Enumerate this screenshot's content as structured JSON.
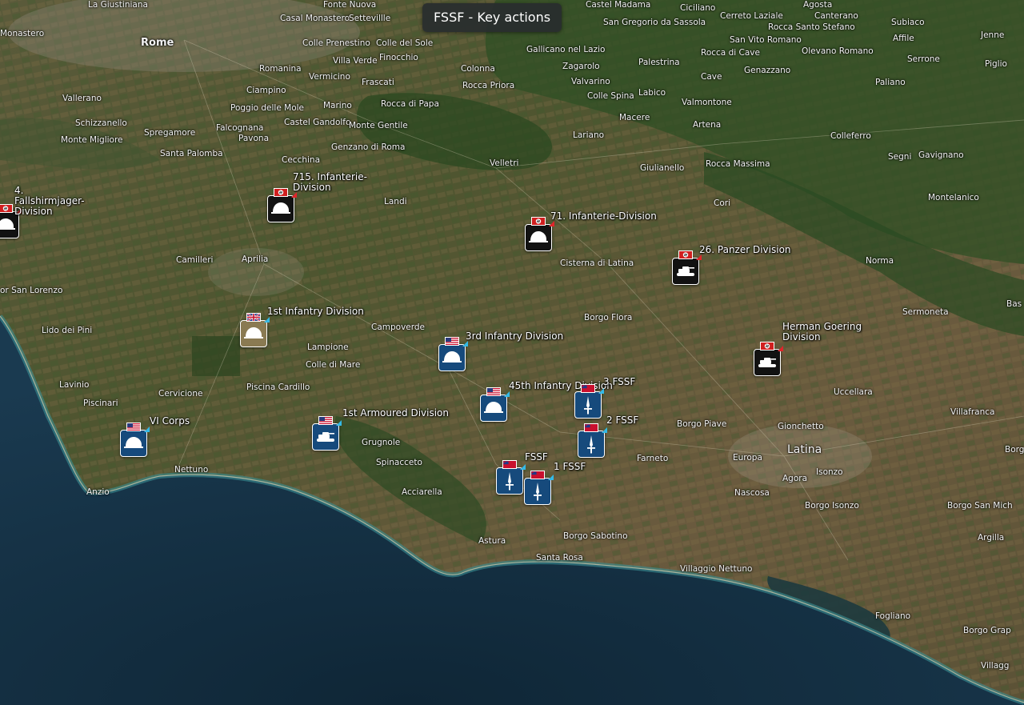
{
  "title_pill": "FSSF - Key actions",
  "places": [
    {
      "name": "La Giustiniana",
      "cls": ""
    },
    {
      "name": "Casal Monastero",
      "cls": ""
    },
    {
      "name": "Settevillle",
      "cls": ""
    },
    {
      "name": "Fonte Nuova",
      "cls": ""
    },
    {
      "name": "Castel Madama",
      "cls": ""
    },
    {
      "name": "Ciciliano",
      "cls": ""
    },
    {
      "name": "Agosta",
      "cls": ""
    },
    {
      "name": "Cerreto Laziale",
      "cls": ""
    },
    {
      "name": "Canterano",
      "cls": ""
    },
    {
      "name": "San Gregorio da Sassola",
      "cls": ""
    },
    {
      "name": "Subiaco",
      "cls": ""
    },
    {
      "name": "Rocca Santo Stefano",
      "cls": ""
    },
    {
      "name": "Jenne",
      "cls": ""
    },
    {
      "name": "Affile",
      "cls": ""
    },
    {
      "name": "Monastero",
      "cls": ""
    },
    {
      "name": "Rome",
      "cls": "city"
    },
    {
      "name": "Colle Prenestino",
      "cls": ""
    },
    {
      "name": "Colle del Sole",
      "cls": ""
    },
    {
      "name": "Gallicano nel Lazio",
      "cls": ""
    },
    {
      "name": "San Vito Romano",
      "cls": ""
    },
    {
      "name": "Rocca di Cave",
      "cls": ""
    },
    {
      "name": "Olevano Romano",
      "cls": ""
    },
    {
      "name": "Serrone",
      "cls": ""
    },
    {
      "name": "Piglio",
      "cls": ""
    },
    {
      "name": "Finocchio",
      "cls": ""
    },
    {
      "name": "Villa Verde",
      "cls": ""
    },
    {
      "name": "Palestrina",
      "cls": ""
    },
    {
      "name": "Zagarolo",
      "cls": ""
    },
    {
      "name": "Colonna",
      "cls": ""
    },
    {
      "name": "Romanina",
      "cls": ""
    },
    {
      "name": "Vermicino",
      "cls": ""
    },
    {
      "name": "Cave",
      "cls": ""
    },
    {
      "name": "Genazzano",
      "cls": ""
    },
    {
      "name": "Frascati",
      "cls": ""
    },
    {
      "name": "Rocca Priora",
      "cls": ""
    },
    {
      "name": "Valvarino",
      "cls": ""
    },
    {
      "name": "Paliano",
      "cls": ""
    },
    {
      "name": "Ciampino",
      "cls": ""
    },
    {
      "name": "Colle Spina",
      "cls": ""
    },
    {
      "name": "Labico",
      "cls": ""
    },
    {
      "name": "Vallerano",
      "cls": ""
    },
    {
      "name": "Marino",
      "cls": ""
    },
    {
      "name": "Rocca di Papa",
      "cls": ""
    },
    {
      "name": "Valmontone",
      "cls": ""
    },
    {
      "name": "Poggio delle Mole",
      "cls": ""
    },
    {
      "name": "Macere",
      "cls": ""
    },
    {
      "name": "Schizzanello",
      "cls": ""
    },
    {
      "name": "Castel Gandolfo",
      "cls": ""
    },
    {
      "name": "Monte Gentile",
      "cls": ""
    },
    {
      "name": "Artena",
      "cls": ""
    },
    {
      "name": "Spregamore",
      "cls": ""
    },
    {
      "name": "Falcognana",
      "cls": ""
    },
    {
      "name": "Lariano",
      "cls": ""
    },
    {
      "name": "Colleferro",
      "cls": ""
    },
    {
      "name": "Monte Migliore",
      "cls": ""
    },
    {
      "name": "Pavona",
      "cls": ""
    },
    {
      "name": "Genzano di Roma",
      "cls": ""
    },
    {
      "name": "Santa Palomba",
      "cls": ""
    },
    {
      "name": "Segni",
      "cls": ""
    },
    {
      "name": "Gavignano",
      "cls": ""
    },
    {
      "name": "Cecchina",
      "cls": ""
    },
    {
      "name": "Velletri",
      "cls": ""
    },
    {
      "name": "Giulianello",
      "cls": ""
    },
    {
      "name": "Rocca Massima",
      "cls": ""
    },
    {
      "name": "Montelanico",
      "cls": ""
    },
    {
      "name": "Landi",
      "cls": ""
    },
    {
      "name": "Cori",
      "cls": ""
    },
    {
      "name": "Camilleri",
      "cls": ""
    },
    {
      "name": "Aprilia",
      "cls": ""
    },
    {
      "name": "Cisterna di Latina",
      "cls": ""
    },
    {
      "name": "Norma",
      "cls": ""
    },
    {
      "name": "or San Lorenzo",
      "cls": ""
    },
    {
      "name": "Sermoneta",
      "cls": ""
    },
    {
      "name": "Bas",
      "cls": ""
    },
    {
      "name": "Borgo Flora",
      "cls": ""
    },
    {
      "name": "Lido dei Pini",
      "cls": ""
    },
    {
      "name": "Campoverde",
      "cls": ""
    },
    {
      "name": "Lampione",
      "cls": ""
    },
    {
      "name": "Colle di Mare",
      "cls": ""
    },
    {
      "name": "Lavinio",
      "cls": ""
    },
    {
      "name": "Piscina Cardillo",
      "cls": ""
    },
    {
      "name": "Uccellara",
      "cls": ""
    },
    {
      "name": "Cervicione",
      "cls": ""
    },
    {
      "name": "Piscinari",
      "cls": ""
    },
    {
      "name": "Villafranca",
      "cls": ""
    },
    {
      "name": "Borgo Piave",
      "cls": ""
    },
    {
      "name": "Gionchetto",
      "cls": ""
    },
    {
      "name": "Grugnole",
      "cls": ""
    },
    {
      "name": "Latina",
      "cls": "big"
    },
    {
      "name": "Borg",
      "cls": ""
    },
    {
      "name": "Europa",
      "cls": ""
    },
    {
      "name": "Farneto",
      "cls": ""
    },
    {
      "name": "Spinacceto",
      "cls": ""
    },
    {
      "name": "Isonzo",
      "cls": ""
    },
    {
      "name": "Agora",
      "cls": ""
    },
    {
      "name": "Nettuno",
      "cls": ""
    },
    {
      "name": "Acciarella",
      "cls": ""
    },
    {
      "name": "Anzio",
      "cls": ""
    },
    {
      "name": "Nascosa",
      "cls": ""
    },
    {
      "name": "Borgo Isonzo",
      "cls": ""
    },
    {
      "name": "Borgo San Mich",
      "cls": ""
    },
    {
      "name": "Argilla",
      "cls": ""
    },
    {
      "name": "Borgo Sabotino",
      "cls": ""
    },
    {
      "name": "Astura",
      "cls": ""
    },
    {
      "name": "Santa Rosa",
      "cls": ""
    },
    {
      "name": "Villaggio Nettuno",
      "cls": ""
    },
    {
      "name": "Fogliano",
      "cls": ""
    },
    {
      "name": "Borgo Grap",
      "cls": ""
    },
    {
      "name": "Villagg",
      "cls": ""
    }
  ],
  "units": [
    {
      "id": "4-fallshirmjager",
      "label": "4. Fallshirmjager-Division",
      "nation": "germany",
      "type": "infantry"
    },
    {
      "id": "715-infanterie",
      "label": "715. Infanterie-Division",
      "nation": "germany",
      "type": "infantry"
    },
    {
      "id": "71-infanterie",
      "label": "71. Infanterie-Division",
      "nation": "germany",
      "type": "infantry"
    },
    {
      "id": "26-panzer",
      "label": "26. Panzer Division",
      "nation": "germany",
      "type": "armour"
    },
    {
      "id": "herman-goering",
      "label": "Herman Goering Division",
      "nation": "germany",
      "type": "armour"
    },
    {
      "id": "1st-infantry",
      "label": "1st Infantry Division",
      "nation": "uk",
      "type": "infantry"
    },
    {
      "id": "3rd-infantry",
      "label": "3rd Infantry Division",
      "nation": "us",
      "type": "infantry"
    },
    {
      "id": "45th-infantry",
      "label": "45th Infantry Division",
      "nation": "us",
      "type": "infantry"
    },
    {
      "id": "vi-corps",
      "label": "VI Corps",
      "nation": "us",
      "type": "infantry"
    },
    {
      "id": "1st-armoured",
      "label": "1st Armoured Division",
      "nation": "us",
      "type": "armour"
    },
    {
      "id": "3-fssf",
      "label": "3 FSSF",
      "nation": "canada",
      "type": "special"
    },
    {
      "id": "2-fssf",
      "label": "2 FSSF",
      "nation": "canada",
      "type": "special"
    },
    {
      "id": "fssf",
      "label": "FSSF",
      "nation": "canada",
      "type": "special"
    },
    {
      "id": "1-fssf",
      "label": "1 FSSF",
      "nation": "canada",
      "type": "special"
    }
  ],
  "colors": {
    "sea": "#173448",
    "sea_deep": "#10283a",
    "coast": "#2f7f86",
    "land_green": "#3e5a2c",
    "land_brown": "#6b5a3c",
    "allied_badge": "#164a7c",
    "uk_badge": "#8a7a52",
    "german_badge": "#121212",
    "allied_corner": "#34b9e6",
    "german_corner": "#e0252b",
    "pill_bg": "#2c3032"
  }
}
